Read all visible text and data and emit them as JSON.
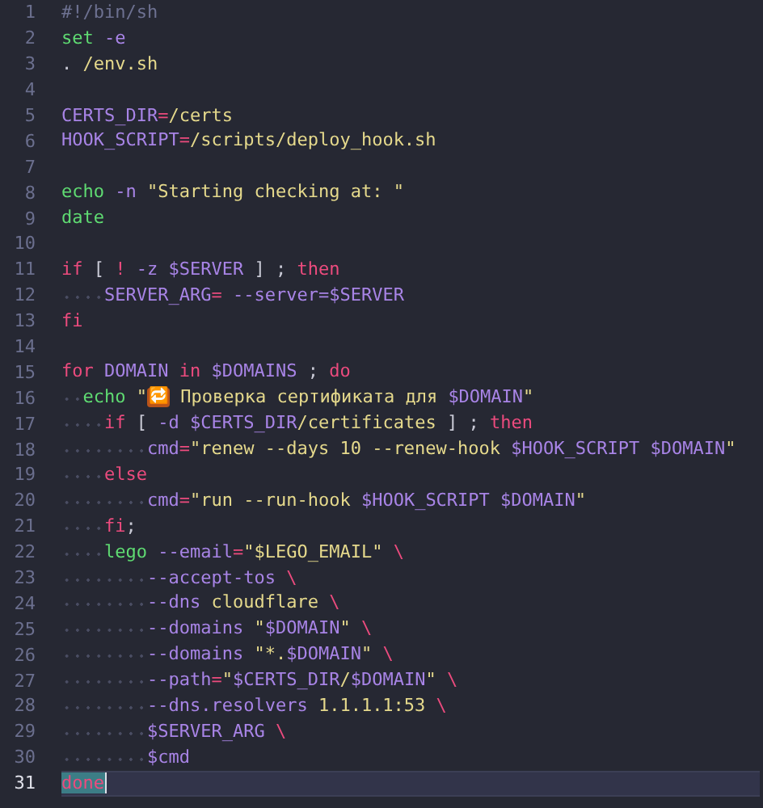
{
  "editor": {
    "lines": [
      {
        "number": "1",
        "selected": false,
        "tokens": [
          {
            "kind": "comment",
            "text": "#!/bin/sh"
          }
        ]
      },
      {
        "number": "2",
        "selected": false,
        "tokens": [
          {
            "kind": "builtin",
            "text": "set"
          },
          {
            "kind": "variable",
            "text": " -e"
          }
        ]
      },
      {
        "number": "3",
        "selected": false,
        "tokens": [
          {
            "kind": "plain",
            "text": ". "
          },
          {
            "kind": "string",
            "text": "/env.sh"
          }
        ]
      },
      {
        "number": "4",
        "selected": false
      },
      {
        "number": "5",
        "selected": false,
        "tokens": [
          {
            "kind": "variable",
            "text": "CERTS_DIR"
          },
          {
            "kind": "operator",
            "text": "="
          },
          {
            "kind": "string",
            "text": "/certs"
          }
        ]
      },
      {
        "number": "6",
        "selected": false,
        "tokens": [
          {
            "kind": "variable",
            "text": "HOOK_SCRIPT"
          },
          {
            "kind": "operator",
            "text": "="
          },
          {
            "kind": "string",
            "text": "/scripts/deploy_hook.sh"
          }
        ]
      },
      {
        "number": "7",
        "selected": false
      },
      {
        "number": "8",
        "selected": false,
        "tokens": [
          {
            "kind": "builtin",
            "text": "echo"
          },
          {
            "kind": "variable",
            "text": " -n"
          },
          {
            "kind": "string",
            "text": " \"Starting checking at: \""
          }
        ]
      },
      {
        "number": "9",
        "selected": false,
        "tokens": [
          {
            "kind": "builtin",
            "text": "date"
          }
        ]
      },
      {
        "number": "10",
        "selected": false
      },
      {
        "number": "11",
        "selected": false,
        "tokens": [
          {
            "kind": "keyword",
            "text": "if"
          },
          {
            "kind": "plain",
            "text": " [ "
          },
          {
            "kind": "keyword",
            "text": "!"
          },
          {
            "kind": "variable",
            "text": " -z"
          },
          {
            "kind": "variable",
            "text": " $SERVER"
          },
          {
            "kind": "plain",
            "text": " ] ; "
          },
          {
            "kind": "keyword",
            "text": "then"
          }
        ]
      },
      {
        "number": "12",
        "selected": false,
        "tokens": [
          {
            "kind": "variable",
            "text": "    SERVER_ARG"
          },
          {
            "kind": "operator",
            "text": "="
          },
          {
            "kind": "variable",
            "text": " --server=$SERVER"
          }
        ]
      },
      {
        "number": "13",
        "selected": false,
        "tokens": [
          {
            "kind": "keyword",
            "text": "fi"
          }
        ]
      },
      {
        "number": "14",
        "selected": false
      },
      {
        "number": "15",
        "selected": false,
        "tokens": [
          {
            "kind": "keyword",
            "text": "for"
          },
          {
            "kind": "variable",
            "text": " DOMAIN"
          },
          {
            "kind": "keyword",
            "text": " in"
          },
          {
            "kind": "variable",
            "text": " $DOMAINS"
          },
          {
            "kind": "plain",
            "text": " ; "
          },
          {
            "kind": "keyword",
            "text": "do"
          }
        ]
      },
      {
        "number": "16",
        "selected": false,
        "tokens": [
          {
            "kind": "builtin",
            "text": "  echo"
          },
          {
            "kind": "string",
            "text": " \""
          },
          {
            "kind": "emoji",
            "text": "🔁"
          },
          {
            "kind": "string",
            "text": " Проверка сертификата для "
          },
          {
            "kind": "variable",
            "text": "$DOMAIN"
          },
          {
            "kind": "string",
            "text": "\""
          }
        ]
      },
      {
        "number": "17",
        "selected": false,
        "tokens": [
          {
            "kind": "keyword",
            "text": "    if"
          },
          {
            "kind": "plain",
            "text": " [ "
          },
          {
            "kind": "variable",
            "text": "-d"
          },
          {
            "kind": "variable",
            "text": " $CERTS_DIR"
          },
          {
            "kind": "string",
            "text": "/certificates"
          },
          {
            "kind": "plain",
            "text": " ] ; "
          },
          {
            "kind": "keyword",
            "text": "then"
          }
        ]
      },
      {
        "number": "18",
        "selected": false,
        "tokens": [
          {
            "kind": "variable",
            "text": "        cmd"
          },
          {
            "kind": "operator",
            "text": "="
          },
          {
            "kind": "string",
            "text": "\"renew --days 10 --renew-hook "
          },
          {
            "kind": "variable",
            "text": "$HOOK_SCRIPT"
          },
          {
            "kind": "variable",
            "text": " $DOMAIN"
          },
          {
            "kind": "string",
            "text": "\""
          }
        ]
      },
      {
        "number": "19",
        "selected": false,
        "tokens": [
          {
            "kind": "keyword",
            "text": "    else"
          }
        ]
      },
      {
        "number": "20",
        "selected": false,
        "tokens": [
          {
            "kind": "variable",
            "text": "        cmd"
          },
          {
            "kind": "operator",
            "text": "="
          },
          {
            "kind": "string",
            "text": "\"run --run-hook "
          },
          {
            "kind": "variable",
            "text": "$HOOK_SCRIPT"
          },
          {
            "kind": "variable",
            "text": " $DOMAIN"
          },
          {
            "kind": "string",
            "text": "\""
          }
        ]
      },
      {
        "number": "21",
        "selected": false,
        "tokens": [
          {
            "kind": "keyword",
            "text": "    fi"
          },
          {
            "kind": "plain",
            "text": ";"
          }
        ]
      },
      {
        "number": "22",
        "selected": false,
        "tokens": [
          {
            "kind": "builtin",
            "text": "    lego"
          },
          {
            "kind": "variable",
            "text": " --email"
          },
          {
            "kind": "operator",
            "text": "="
          },
          {
            "kind": "string",
            "text": "\"$LEGO_EMAIL\""
          },
          {
            "kind": "operator",
            "text": " \\"
          }
        ]
      },
      {
        "number": "23",
        "selected": false,
        "tokens": [
          {
            "kind": "variable",
            "text": "        --accept-tos"
          },
          {
            "kind": "operator",
            "text": " \\"
          }
        ]
      },
      {
        "number": "24",
        "selected": false,
        "tokens": [
          {
            "kind": "variable",
            "text": "        --dns"
          },
          {
            "kind": "string",
            "text": " cloudflare"
          },
          {
            "kind": "operator",
            "text": " \\"
          }
        ]
      },
      {
        "number": "25",
        "selected": false,
        "tokens": [
          {
            "kind": "variable",
            "text": "        --domains"
          },
          {
            "kind": "string",
            "text": " \""
          },
          {
            "kind": "variable",
            "text": "$DOMAIN"
          },
          {
            "kind": "string",
            "text": "\""
          },
          {
            "kind": "operator",
            "text": " \\"
          }
        ]
      },
      {
        "number": "26",
        "selected": false,
        "tokens": [
          {
            "kind": "variable",
            "text": "        --domains"
          },
          {
            "kind": "string",
            "text": " \"*."
          },
          {
            "kind": "variable",
            "text": "$DOMAIN"
          },
          {
            "kind": "string",
            "text": "\""
          },
          {
            "kind": "operator",
            "text": " \\"
          }
        ]
      },
      {
        "number": "27",
        "selected": false,
        "tokens": [
          {
            "kind": "variable",
            "text": "        --path"
          },
          {
            "kind": "operator",
            "text": "="
          },
          {
            "kind": "string",
            "text": "\""
          },
          {
            "kind": "variable",
            "text": "$CERTS_DIR"
          },
          {
            "kind": "string",
            "text": "/"
          },
          {
            "kind": "variable",
            "text": "$DOMAIN"
          },
          {
            "kind": "string",
            "text": "\""
          },
          {
            "kind": "operator",
            "text": " \\"
          }
        ]
      },
      {
        "number": "28",
        "selected": false,
        "tokens": [
          {
            "kind": "variable",
            "text": "        --dns.resolvers"
          },
          {
            "kind": "string",
            "text": " 1.1.1.1:53"
          },
          {
            "kind": "operator",
            "text": " \\"
          }
        ]
      },
      {
        "number": "29",
        "selected": false,
        "tokens": [
          {
            "kind": "variable",
            "text": "        $SERVER_ARG"
          },
          {
            "kind": "operator",
            "text": " \\"
          }
        ]
      },
      {
        "number": "30",
        "selected": false,
        "tokens": [
          {
            "kind": "variable",
            "text": "        $cmd"
          }
        ]
      },
      {
        "number": "31",
        "selected": true,
        "tokens": [
          {
            "kind": "keyword",
            "text": "done"
          }
        ]
      }
    ]
  }
}
